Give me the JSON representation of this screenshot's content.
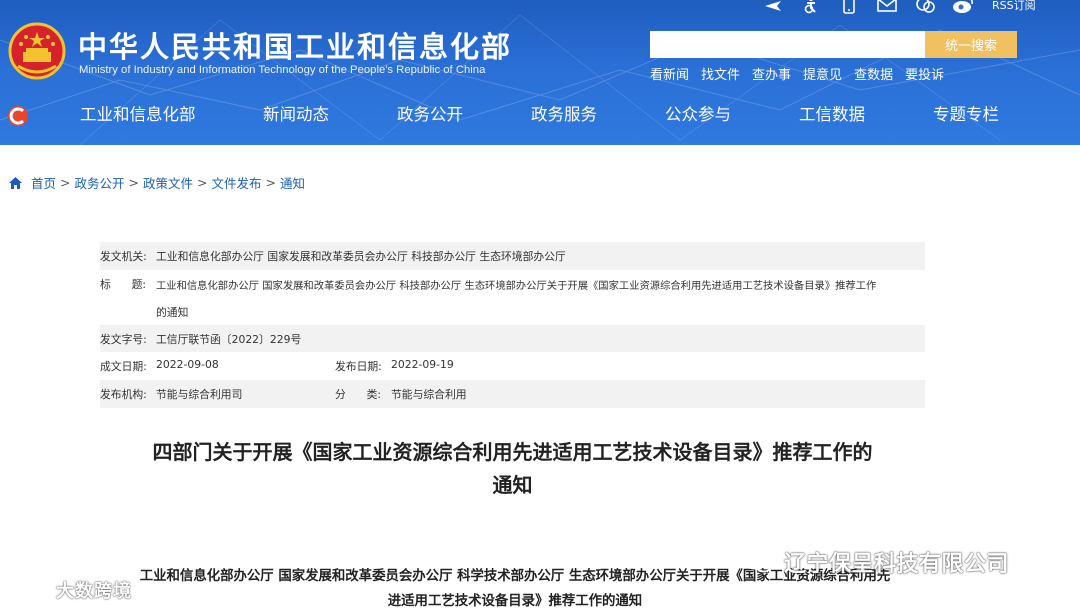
{
  "header": {
    "title": "中华人民共和国工业和信息化部",
    "subtitle": "Ministry of Industry and Information Technology of the People's Republic of China",
    "top_icons": [
      "plane-icon",
      "accessibility-icon",
      "mobile-icon",
      "mail-icon",
      "chat-icon",
      "weibo-icon"
    ],
    "rss_label": "RSS订阅",
    "search": {
      "placeholder": "",
      "button_label": "统一搜索"
    },
    "quick_links": [
      "看新闻",
      "找文件",
      "查办事",
      "提意见",
      "查数据",
      "要投诉"
    ],
    "nav": [
      "工业和信息化部",
      "新闻动态",
      "政务公开",
      "政务服务",
      "公众参与",
      "工信数据",
      "专题专栏"
    ],
    "colors": {
      "header_blue": "#2a6fd6",
      "search_button": "#f0c061"
    }
  },
  "breadcrumb": [
    "首页",
    "政务公开",
    "政策文件",
    "文件发布",
    "通知"
  ],
  "meta": {
    "issuer_label": "发文机关:",
    "issuer": "工业和信息化部办公厅 国家发展和改革委员会办公厅 科技部办公厅 生态环境部办公厅",
    "title_label_a": "标",
    "title_label_b": "题:",
    "title_line1": "工业和信息化部办公厅 国家发展和改革委员会办公厅 科技部办公厅 生态环境部办公厅关于开展《国家工业资源综合利用先进适用工艺技术设备目录》推荐工作",
    "title_line2": "的通知",
    "doc_no_label": "发文字号:",
    "doc_no": "工信厅联节函〔2022〕229号",
    "created_label": "成文日期:",
    "created": "2022-09-08",
    "published_label": "发布日期:",
    "published": "2022-09-19",
    "org_label": "发布机构:",
    "org": "节能与综合利用司",
    "category_label_a": "分",
    "category_label_b": "类:",
    "category": "节能与综合利用"
  },
  "doc": {
    "title_line1": "四部门关于开展《国家工业资源综合利用先进适用工艺技术设备目录》推荐工作的",
    "title_line2": "通知",
    "body_line1": "工业和信息化部办公厅 国家发展和改革委员会办公厅 科学技术部办公厅 生态环境部办公厅关于开展《国家工业资源综合利用先",
    "body_line2": "进适用工艺技术设备目录》推荐工作的通知"
  },
  "watermarks": {
    "left": "大数跨境",
    "right": "辽宁保呈科技有限公司"
  }
}
